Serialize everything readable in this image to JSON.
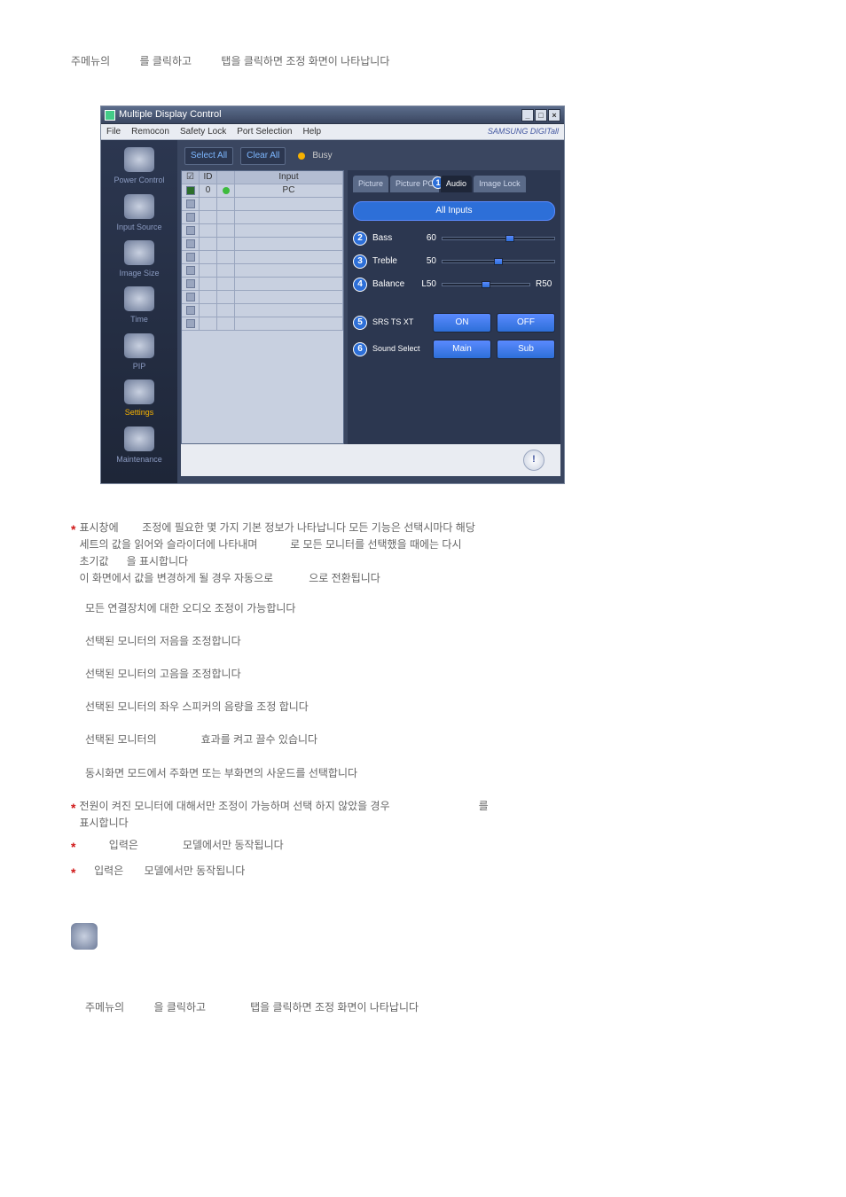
{
  "page": {
    "header_line_a": "주메뉴의",
    "header_line_b": "를 클릭하고",
    "header_line_c": "탭을 클릭하면 조정 화면이 나타납니다",
    "footer_line_a": "주메뉴의",
    "footer_line_b": "을 클릭하고",
    "footer_line_c": "탭을 클릭하면 조정 화면이 나타납니다"
  },
  "window": {
    "title": "Multiple Display Control",
    "brand": "SAMSUNG DIGITall",
    "menu": {
      "file": "File",
      "remocon": "Remocon",
      "safety_lock": "Safety Lock",
      "port_selection": "Port Selection",
      "help": "Help"
    },
    "win_min": "_",
    "win_max": "□",
    "win_close": "×"
  },
  "sidebar": {
    "power": "Power Control",
    "input": "Input Source",
    "imgsize": "Image Size",
    "time": "Time",
    "pip": "PIP",
    "settings": "Settings",
    "maint": "Maintenance"
  },
  "toolbar": {
    "select_all": "Select All",
    "clear_all": "Clear All",
    "busy": "Busy"
  },
  "grid": {
    "hdr_chk": "☑",
    "hdr_id": "ID",
    "hdr_status": "",
    "hdr_input": "Input",
    "rows": [
      {
        "id": "0",
        "input": "PC",
        "checked": true,
        "status": true
      },
      {
        "id": "",
        "input": "",
        "checked": false,
        "status": false
      },
      {
        "id": "",
        "input": "",
        "checked": false,
        "status": false
      },
      {
        "id": "",
        "input": "",
        "checked": false,
        "status": false
      },
      {
        "id": "",
        "input": "",
        "checked": false,
        "status": false
      },
      {
        "id": "",
        "input": "",
        "checked": false,
        "status": false
      },
      {
        "id": "",
        "input": "",
        "checked": false,
        "status": false
      },
      {
        "id": "",
        "input": "",
        "checked": false,
        "status": false
      },
      {
        "id": "",
        "input": "",
        "checked": false,
        "status": false
      },
      {
        "id": "",
        "input": "",
        "checked": false,
        "status": false
      },
      {
        "id": "",
        "input": "",
        "checked": false,
        "status": false
      }
    ]
  },
  "panel": {
    "tabs": {
      "picture": "Picture",
      "picture_pc": "Picture PC",
      "audio": "Audio",
      "image_lock": "Image Lock",
      "num1": "1"
    },
    "all_inputs": "All Inputs",
    "sliders": {
      "bass_num": "2",
      "bass_label": "Bass",
      "bass_val": "60",
      "treble_num": "3",
      "treble_label": "Treble",
      "treble_val": "50",
      "balance_num": "4",
      "balance_label": "Balance",
      "balance_l": "L50",
      "balance_r": "R50"
    },
    "srs": {
      "num": "5",
      "label": "SRS TS XT",
      "on": "ON",
      "off": "OFF"
    },
    "sound": {
      "num": "6",
      "label": "Sound Select",
      "main": "Main",
      "sub": "Sub"
    }
  },
  "desc": {
    "p1a": "표시창에",
    "p1b": "조정에 필요한 몇 가지 기본 정보가 나타납니다  모든 기능은 선택시마다 해당",
    "p1c": "세트의 값을 읽어와 슬라이더에 나타내며",
    "p1d": "로 모든 모니터를 선택했을 때에는 다시",
    "p1e": "초기값",
    "p1f": "을 표시합니다",
    "p1g": "이 화면에서 값을 변경하게 될 경우 자동으로",
    "p1h": "으로 전환됩니다",
    "l1": "모든 연결장치에 대한 오디오 조정이 가능합니다",
    "l2": "선택된 모니터의 저음을 조정합니다",
    "l3": "선택된 모니터의 고음을 조정합니다",
    "l4": "선택된 모니터의 좌우 스피커의 음량을 조정 합니다",
    "l5a": "선택된 모니터의",
    "l5b": "효과를 켜고 끌수 있습니다",
    "l6": "동시화면 모드에서 주화면 또는 부화면의 사운드를 선택합니다",
    "p2a": "전원이 켜진 모니터에 대해서만 조정이 가능하며  선택 하지 않았을 경우",
    "p2b": "를",
    "p2c": "표시합니다",
    "p3a": "입력은",
    "p3b": "모델에서만 동작됩니다",
    "p4a": "입력은",
    "p4b": "모델에서만 동작됩니다"
  }
}
